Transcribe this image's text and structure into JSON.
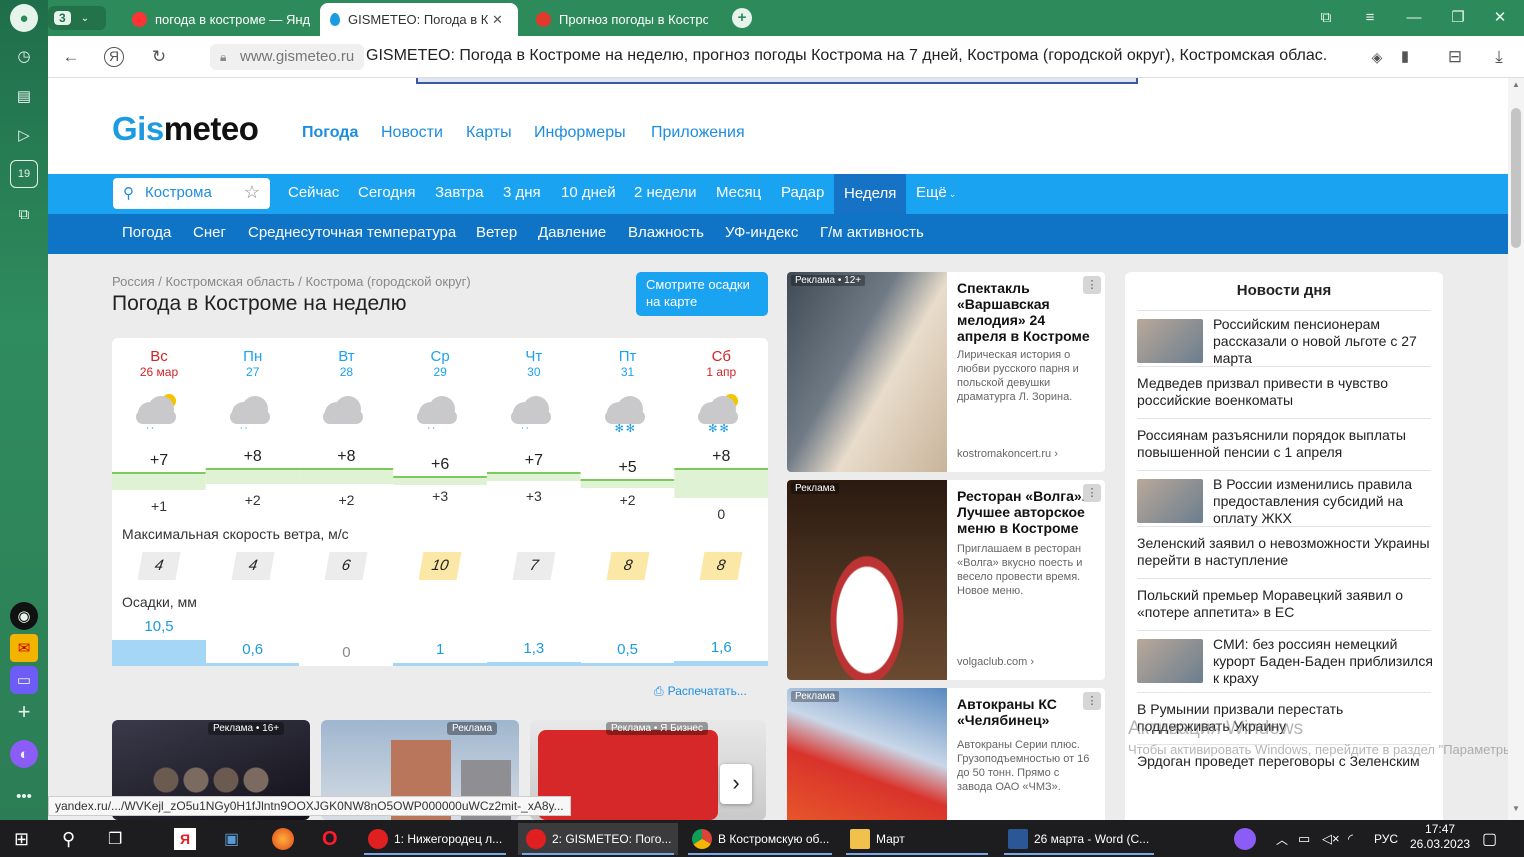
{
  "browser": {
    "tab_count": "3",
    "tabs": [
      {
        "label": "погода в костроме — Янд"
      },
      {
        "label": "GISMETEO: Погода в Ко"
      },
      {
        "label": "Прогноз погоды в Костро"
      }
    ],
    "url_domain": "www.gismeteo.ru",
    "page_title": "GISMETEO: Погода в Костроме на неделю, прогноз погоды Кострома на 7 дней, Кострома (городской округ), Костромская облас..."
  },
  "site": {
    "logo_gis": "Gis",
    "logo_meteo": "meteo",
    "main_nav": [
      "Погода",
      "Новости",
      "Карты",
      "Информеры",
      "Приложения"
    ],
    "search_value": "Кострома",
    "period_nav": [
      "Сейчас",
      "Сегодня",
      "Завтра",
      "3 дня",
      "10 дней",
      "2 недели",
      "Месяц",
      "Радар",
      "Неделя",
      "Ещё"
    ],
    "sub_nav": [
      "Погода",
      "Снег",
      "Среднесуточная температура",
      "Ветер",
      "Давление",
      "Влажность",
      "УФ-индекс",
      "Г/м активность"
    ]
  },
  "forecast": {
    "breadcrumb": "Россия / Костромская область / Кострома (городской округ)",
    "title": "Погода в Костроме на неделю",
    "precip_map_button": "Смотрите осадки на карте",
    "days": [
      {
        "name": "Вс",
        "date": "26 мар",
        "weekend": true,
        "tmax": "+7",
        "tmin": "+1",
        "wind": "4",
        "precip": "10,5",
        "precip_value": 10.5,
        "icon": "sun-cloud-rain-icon"
      },
      {
        "name": "Пн",
        "date": "27",
        "weekend": false,
        "tmax": "+8",
        "tmin": "+2",
        "wind": "4",
        "precip": "0,6",
        "precip_value": 0.6,
        "icon": "cloud-rain-icon"
      },
      {
        "name": "Вт",
        "date": "28",
        "weekend": false,
        "tmax": "+8",
        "tmin": "+2",
        "wind": "6",
        "precip": "0",
        "precip_value": 0,
        "icon": "cloud-icon"
      },
      {
        "name": "Ср",
        "date": "29",
        "weekend": false,
        "tmax": "+6",
        "tmin": "+3",
        "wind": "10",
        "precip": "1",
        "precip_value": 1,
        "icon": "cloud-rain-icon"
      },
      {
        "name": "Чт",
        "date": "30",
        "weekend": false,
        "tmax": "+7",
        "tmin": "+3",
        "wind": "7",
        "precip": "1,3",
        "precip_value": 1.3,
        "icon": "cloud-rain-icon"
      },
      {
        "name": "Пт",
        "date": "31",
        "weekend": false,
        "tmax": "+5",
        "tmin": "+2",
        "wind": "8",
        "precip": "0,5",
        "precip_value": 0.5,
        "icon": "cloud-snow-icon"
      },
      {
        "name": "Сб",
        "date": "1 апр",
        "weekend": true,
        "tmax": "+8",
        "tmin": "0",
        "wind": "8",
        "precip": "1,6",
        "precip_value": 1.6,
        "icon": "sun-cloud-snow-icon"
      }
    ],
    "wind_label": "Максимальная скорость ветра, м/с",
    "precip_label": "Осадки, мм",
    "print_link": "Распечатать..."
  },
  "bottom_ads": [
    {
      "badge": "Реклама • 16+"
    },
    {
      "badge": "Реклама"
    },
    {
      "badge": "Реклама • Я Бизнес"
    }
  ],
  "ads": [
    {
      "label": "Реклама • 12+",
      "title": "Спектакль «Варшавская мелодия» 24 апреля в Костроме",
      "desc": "Лирическая история о любви русского парня и польской девушки драматурга Л. Зорина.",
      "domain": "kostromakoncert.ru ›"
    },
    {
      "label": "Реклама",
      "title": "Ресторан «Волга». Лучшее авторское меню в Костроме",
      "desc": "Приглашаем в ресторан «Волга» вкусно поесть и весело провести время. Новое меню.",
      "domain": "volgaclub.com ›"
    },
    {
      "label": "Реклама",
      "title": "Автокраны КС «Челябинец»",
      "desc": "Автокраны Серии плюс. Грузоподъемностью от 16 до 50 тонн. Прямо с завода ОАО «ЧМЗ».",
      "domain": ""
    }
  ],
  "news": {
    "title": "Новости дня",
    "items": [
      {
        "text": "Российским пенсионерам рассказали о новой льготе с 27 марта",
        "thumb": true
      },
      {
        "text": "Медведев призвал привести в чувство российские военкоматы",
        "thumb": false
      },
      {
        "text": "Россиянам разъяснили порядок выплаты повышенной пенсии с 1 апреля",
        "thumb": false
      },
      {
        "text": "В России изменились правила предоставления субсидий на оплату ЖКХ",
        "thumb": true
      },
      {
        "text": "Зеленский заявил о невозможности Украины перейти в наступление",
        "thumb": false
      },
      {
        "text": "Польский премьер Моравецкий заявил о «потере аппетита» в ЕС",
        "thumb": false
      },
      {
        "text": "СМИ: без россиян немецкий курорт Баден-Баден приблизился к краху",
        "thumb": true
      },
      {
        "text": "В Румынии призвали перестать поддерживать Украину",
        "thumb": false
      },
      {
        "text": "Эрдоган проведет переговоры с Зеленским",
        "thumb": false
      }
    ]
  },
  "status_url": "yandex.ru/.../WVKejl_zO5u1NGy0H1fJlntn9OOXJGK0NW8nO5OWP000000uWCz2mit-_xA8y...",
  "windows_watermark": {
    "line1": "Активация Windows",
    "line2": "Чтобы активировать Windows, перейдите в раздел \"Параметры\"."
  },
  "taskbar": {
    "apps": [
      {
        "label": "1: Нижегородец л..."
      },
      {
        "label": "2: GISMETEO: Пого..."
      },
      {
        "label": "В Костромскую об..."
      },
      {
        "label": "Март"
      },
      {
        "label": "26 марта - Word (С..."
      }
    ],
    "lang": "РУС",
    "time": "17:47",
    "date": "26.03.2023"
  },
  "colors": {
    "accent": "#1aa3f0",
    "nav_dark": "#0f74c5",
    "browser_green": "#2d8a5a",
    "weekend_red": "#d1232a"
  }
}
